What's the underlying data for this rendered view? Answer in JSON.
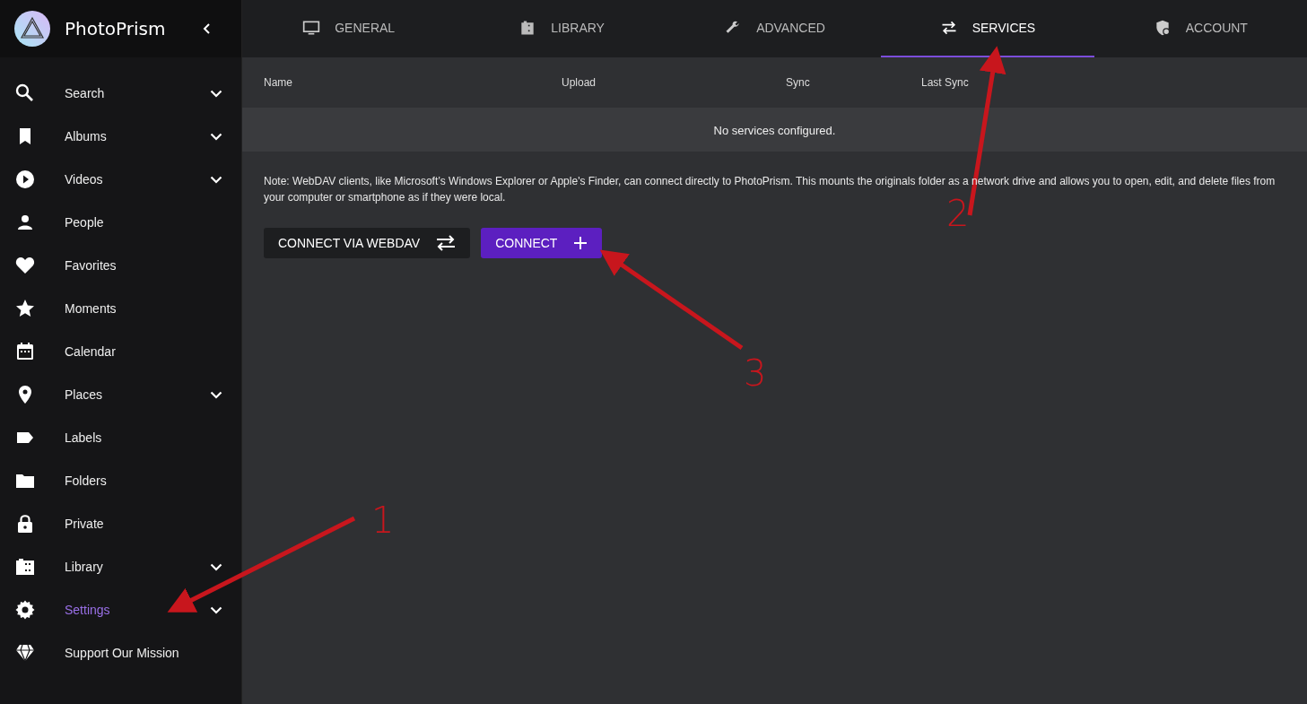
{
  "app": {
    "name": "PhotoPrism"
  },
  "sidebar": {
    "items": [
      {
        "label": "Search",
        "expandable": true,
        "selected": false
      },
      {
        "label": "Albums",
        "expandable": true,
        "selected": false
      },
      {
        "label": "Videos",
        "expandable": true,
        "selected": false
      },
      {
        "label": "People",
        "expandable": false,
        "selected": false
      },
      {
        "label": "Favorites",
        "expandable": false,
        "selected": false
      },
      {
        "label": "Moments",
        "expandable": false,
        "selected": false
      },
      {
        "label": "Calendar",
        "expandable": false,
        "selected": false
      },
      {
        "label": "Places",
        "expandable": true,
        "selected": false
      },
      {
        "label": "Labels",
        "expandable": false,
        "selected": false
      },
      {
        "label": "Folders",
        "expandable": false,
        "selected": false
      },
      {
        "label": "Private",
        "expandable": false,
        "selected": false
      },
      {
        "label": "Library",
        "expandable": true,
        "selected": false
      },
      {
        "label": "Settings",
        "expandable": true,
        "selected": true
      },
      {
        "label": "Support Our Mission",
        "expandable": false,
        "selected": false
      }
    ]
  },
  "tabs": [
    {
      "label": "GENERAL",
      "selected": false
    },
    {
      "label": "LIBRARY",
      "selected": false
    },
    {
      "label": "ADVANCED",
      "selected": false
    },
    {
      "label": "SERVICES",
      "selected": true
    },
    {
      "label": "ACCOUNT",
      "selected": false
    }
  ],
  "table": {
    "columns": [
      "Name",
      "Upload",
      "Sync",
      "Last Sync"
    ],
    "empty_message": "No services configured."
  },
  "note": "Note: WebDAV clients, like Microsoft’s Windows Explorer or Apple's Finder, can connect directly to PhotoPrism. This mounts the originals folder as a network drive and allows you to open, edit, and delete files from your computer or smartphone as if they were local.",
  "buttons": [
    {
      "label": "CONNECT VIA WEBDAV",
      "kind": "secondary"
    },
    {
      "label": "CONNECT",
      "kind": "primary"
    }
  ],
  "annotations": [
    {
      "label": "1"
    },
    {
      "label": "2"
    },
    {
      "label": "3"
    }
  ]
}
